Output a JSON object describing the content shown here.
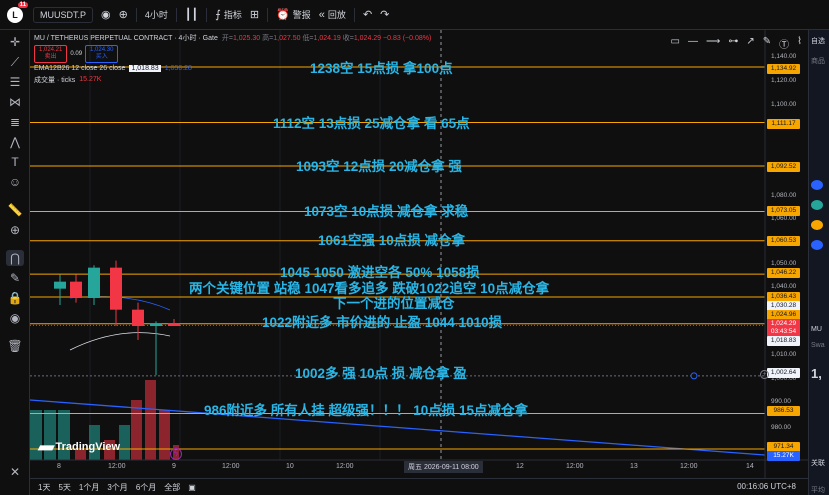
{
  "toolbar": {
    "avatar_letter": "L",
    "notif_count": "11",
    "symbol": "MUUSDT.P",
    "interval": "4小时",
    "indicators": "指标",
    "alert": "警报",
    "replay": "回放"
  },
  "legend": {
    "title": "MU / TETHERUS PERPETUAL CONTRACT · 4小时 · Gate",
    "o_label": "开=",
    "o": "1,025.30",
    "h_label": "高=",
    "h": "1,027.50",
    "l_label": "低=",
    "l": "1,024.19",
    "c_label": "收=",
    "c": "1,024.29",
    "chg": "−0.83 (−0.08%)",
    "sell_price": "1,024.21",
    "sell_label": "卖出",
    "spread": "0.09",
    "buy_price": "1,024.30",
    "buy_label": "买入",
    "ema_label": "EMA12B26 12 close 26 close",
    "ema_v1": "1,018.83",
    "ema_v2": "1,030.28",
    "vol_label": "成交量 · ticks",
    "vol_value": "15.27K"
  },
  "annotations": [
    "1238空   15点损    拿100点",
    "1112空     13点损    25减仓拿  看   65点",
    "1093空    12点损   20减仓拿    强",
    "1073空    10点损  减仓拿  求稳",
    "1061空强    10点损  减仓拿",
    "1045      1050  激进空各 50%   1058损",
    "两个关键位置  站稳  1047看多追多   跌破1022追空   10点减仓拿",
    "下一个进的位置减仓",
    "1022附近多  市价进的  止盈  1044  1010损",
    "1002多  强   10点  损    减仓拿  盈",
    "986附近多  所有人挂   超级强！！！    10点损    15点减仓拿"
  ],
  "price_axis": {
    "ticks": [
      "1,140.00",
      "1,120.00",
      "1,100.00",
      "1,080.00",
      "1,060.00",
      "1,050.00",
      "1,040.00",
      "1,010.00",
      "1,000.00",
      "990.00",
      "980.00"
    ],
    "labels": [
      {
        "text": "1,134.92",
        "bg": "#f7a600"
      },
      {
        "text": "1,111.17",
        "bg": "#f7a600"
      },
      {
        "text": "1,092.52",
        "bg": "#f7a600"
      },
      {
        "text": "1,073.05",
        "bg": "#f7a600"
      },
      {
        "text": "1,060.53",
        "bg": "#f7a600"
      },
      {
        "text": "1,046.22",
        "bg": "#f7a600"
      },
      {
        "text": "1,036.43",
        "bg": "#f7a600"
      },
      {
        "text": "1,030.28",
        "bg": "#f0f3fa"
      },
      {
        "text": "1,024.96",
        "bg": "#f7a600"
      },
      {
        "text": "1,024.29",
        "bg": "#f23645"
      },
      {
        "text": "03:43:54",
        "bg": "#f23645"
      },
      {
        "text": "1,018.83",
        "bg": "#f0f3fa"
      },
      {
        "text": "1,002.64",
        "bg": "#f0f3fa"
      },
      {
        "text": "986.53",
        "bg": "#f7a600"
      },
      {
        "text": "971.34",
        "bg": "#f7a600"
      },
      {
        "text": "15.27K",
        "bg": "#2962ff"
      }
    ]
  },
  "time_axis": {
    "ticks": [
      "8",
      "12:00",
      "9",
      "12:00",
      "10",
      "12:00",
      "12",
      "12:00",
      "13",
      "12:00",
      "14"
    ],
    "cursor": "周五 2026-09-11   08:00"
  },
  "chart_data": {
    "type": "candlestick",
    "x": [
      "8 12:00",
      "8 16:00",
      "8 20:00",
      "9 00:00",
      "9 04:00",
      "9 08:00",
      "9 12:00"
    ],
    "candles": [
      {
        "o": 1040,
        "h": 1046,
        "l": 1033,
        "c": 1043
      },
      {
        "o": 1043,
        "h": 1046,
        "l": 1034,
        "c": 1036
      },
      {
        "o": 1036,
        "h": 1050,
        "l": 1033,
        "c": 1049
      },
      {
        "o": 1049,
        "h": 1052,
        "l": 1024,
        "c": 1031
      },
      {
        "o": 1031,
        "h": 1034,
        "l": 1018,
        "c": 1024
      },
      {
        "o": 1024,
        "h": 1026,
        "l": 1003,
        "c": 1025
      },
      {
        "o": 1025,
        "h": 1027,
        "l": 1024,
        "c": 1024
      }
    ],
    "levels": [
      1134.92,
      1111.17,
      1092.52,
      1073.05,
      1060.53,
      1046.22,
      1036.43,
      1024.96,
      1002.64,
      986.53,
      971.34
    ],
    "ylim": [
      968,
      1148
    ]
  },
  "brand": {
    "tradingview": "TradingView"
  },
  "bottom": {
    "ranges": [
      "1天",
      "5天",
      "1个月",
      "3个月",
      "6个月",
      "全部"
    ],
    "clock": "00:16:06 UTC+8"
  },
  "right_panel": [
    "自选",
    "商品",
    "MU",
    "Swa",
    "1,",
    "关联",
    "平均"
  ]
}
